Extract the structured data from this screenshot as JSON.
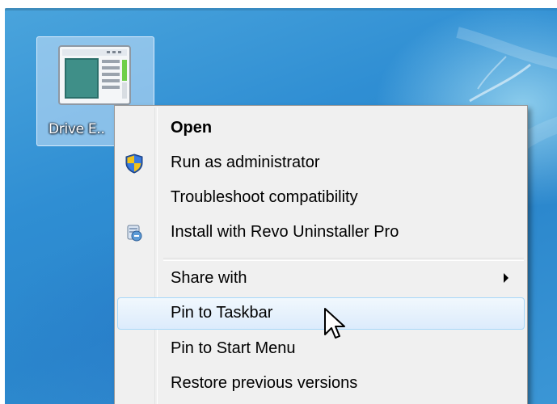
{
  "desktop_icon": {
    "label": "Drive E..",
    "icon": "application-window-icon"
  },
  "context_menu": {
    "items": [
      {
        "label": "Open",
        "default": true,
        "icon": null
      },
      {
        "label": "Run as administrator",
        "icon": "uac-shield-icon"
      },
      {
        "label": "Troubleshoot compatibility",
        "icon": null
      },
      {
        "label": "Install with Revo Uninstaller Pro",
        "icon": "revo-uninstaller-icon"
      },
      {
        "label": "Share with",
        "icon": null,
        "submenu": true
      },
      {
        "label": "Pin to Taskbar",
        "icon": null,
        "highlighted": true
      },
      {
        "label": "Pin to Start Menu",
        "icon": null
      },
      {
        "label": "Restore previous versions",
        "icon": null
      }
    ]
  },
  "colors": {
    "desktop_blue": "#2f8ed3",
    "menu_background": "#f0f0f0",
    "highlight_border": "#a8d8f8",
    "highlight_fill": "#dcebfc"
  }
}
